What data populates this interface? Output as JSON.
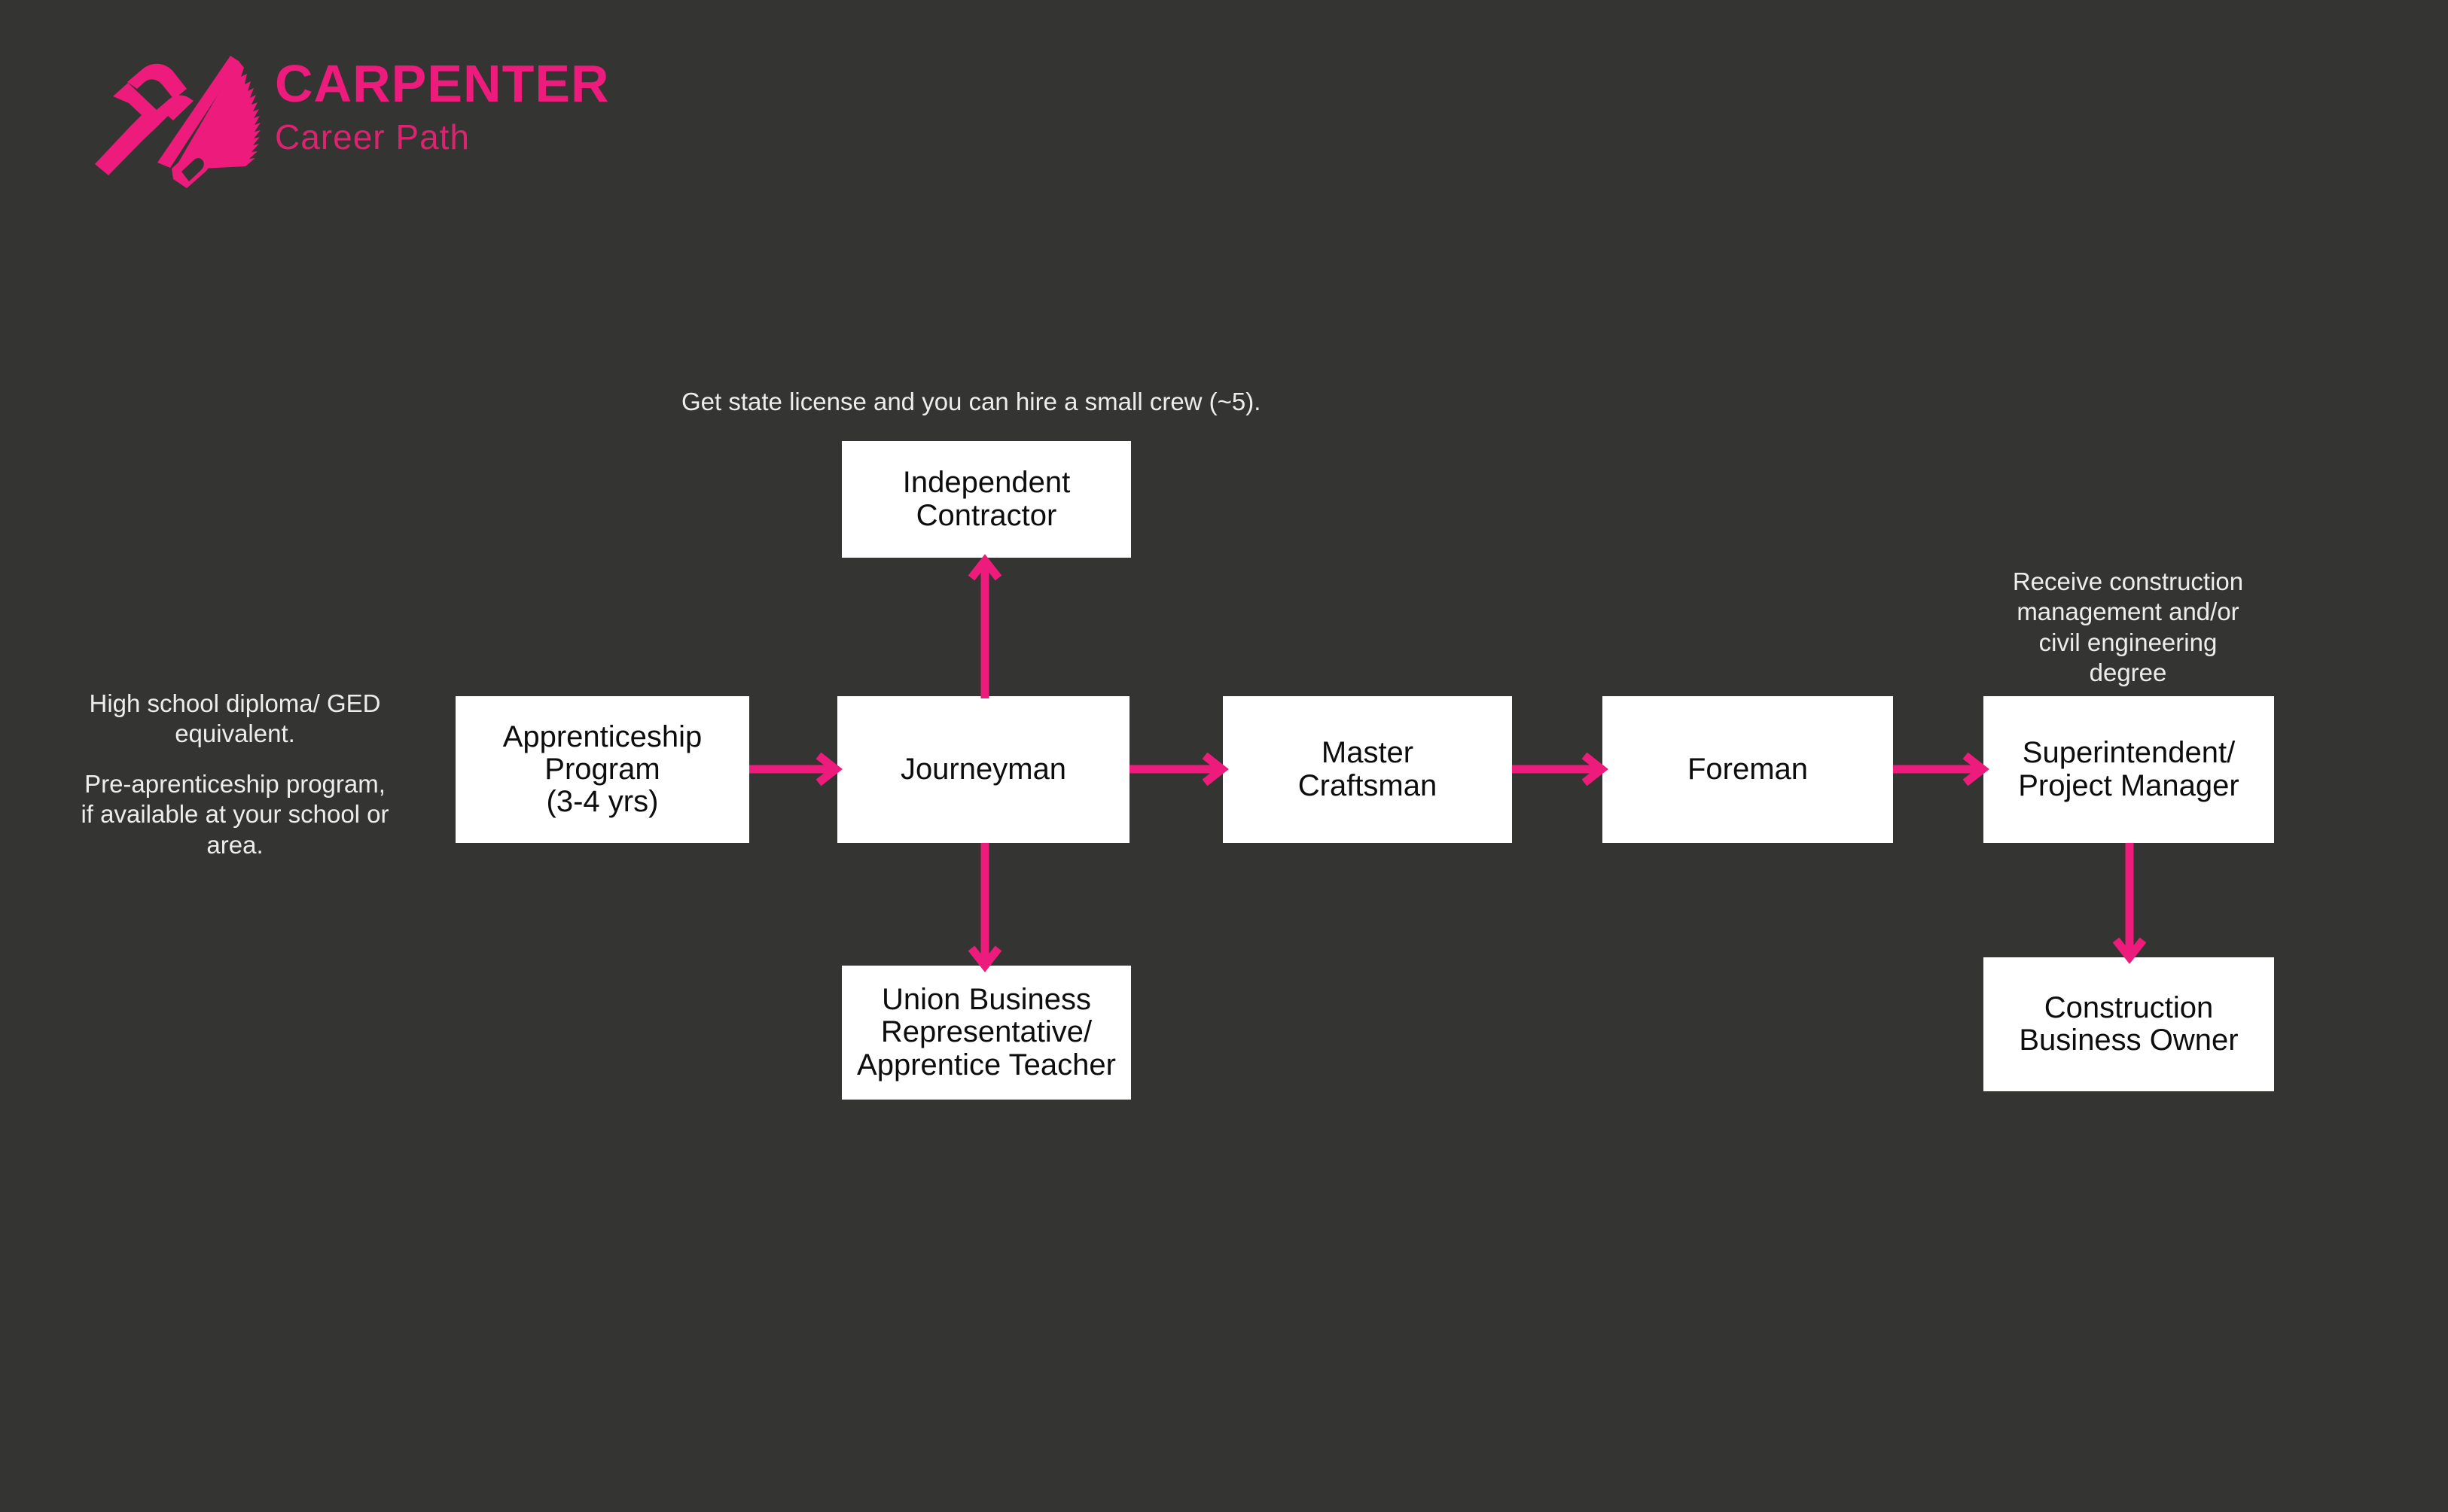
{
  "brand": {
    "title": "CARPENTER",
    "subtitle": "Career Path",
    "logo_icon": "hammer-and-saw-icon",
    "accent_color": "#EC1B7C",
    "subtitle_color": "#DB2370",
    "background_color": "#343432"
  },
  "notes": {
    "prerequisites": "High school diploma/ GED\nequivalent.",
    "prerequisites_secondary": "Pre-aprenticeship program,\nif available at your school or\narea.",
    "contractor_note": "Get state license and you can hire a small crew (~5).",
    "superintendent_note": "Receive construction\nmanagement and/or\ncivil engineering\ndegree"
  },
  "nodes": {
    "apprenticeship": "Apprenticeship\nProgram\n(3-4 yrs)",
    "journeyman": "Journeyman",
    "independent_contractor": "Independent\nContractor",
    "union_business_rep": "Union Business\nRepresentative/\nApprentice Teacher",
    "master_craftsman": "Master\nCraftsman",
    "foreman": "Foreman",
    "superintendent": "Superintendent/\nProject Manager",
    "business_owner": "Construction\nBusiness Owner"
  },
  "flow": {
    "edges": [
      {
        "from": "apprenticeship",
        "to": "journeyman",
        "direction": "right"
      },
      {
        "from": "journeyman",
        "to": "independent_contractor",
        "direction": "up"
      },
      {
        "from": "journeyman",
        "to": "union_business_rep",
        "direction": "down"
      },
      {
        "from": "journeyman",
        "to": "master_craftsman",
        "direction": "right"
      },
      {
        "from": "master_craftsman",
        "to": "foreman",
        "direction": "right"
      },
      {
        "from": "foreman",
        "to": "superintendent",
        "direction": "right"
      },
      {
        "from": "superintendent",
        "to": "business_owner",
        "direction": "down"
      }
    ],
    "arrow_color": "#EC1B7C"
  }
}
